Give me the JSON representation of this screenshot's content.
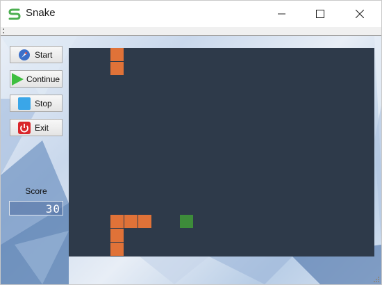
{
  "window": {
    "title": "Snake"
  },
  "controls": {
    "start_label": "Start",
    "continue_label": "Continue",
    "stop_label": "Stop",
    "exit_label": "Exit"
  },
  "score": {
    "label": "Score",
    "value": "30"
  },
  "game": {
    "board_color": "#2e3a4a",
    "snake_color": "#e07238",
    "food_color": "#3d8c3a",
    "snake": [
      [
        3,
        0
      ],
      [
        3,
        1
      ],
      [
        3,
        12
      ],
      [
        4,
        12
      ],
      [
        5,
        12
      ],
      [
        3,
        13
      ],
      [
        3,
        14
      ]
    ],
    "food": [
      8,
      12
    ]
  }
}
